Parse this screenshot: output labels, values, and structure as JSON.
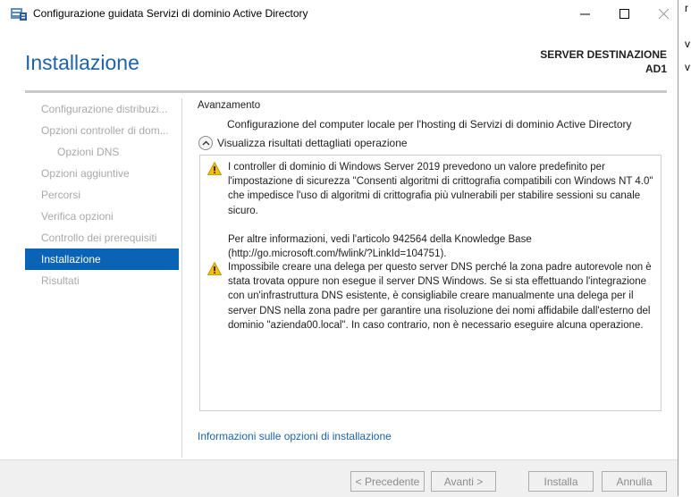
{
  "window": {
    "title": "Configurazione guidata Servizi di dominio Active Directory",
    "minimize_glyph": "—",
    "maximize_glyph": "☐",
    "close_glyph": "✕"
  },
  "header": {
    "page_title": "Installazione",
    "destination_label": "SERVER DESTINAZIONE",
    "destination_server": "AD1"
  },
  "nav": {
    "items": [
      {
        "label": "Configurazione distribuzi..."
      },
      {
        "label": "Opzioni controller di dom..."
      },
      {
        "label": "Opzioni DNS"
      },
      {
        "label": "Opzioni aggiuntive"
      },
      {
        "label": "Percorsi"
      },
      {
        "label": "Verifica opzioni"
      },
      {
        "label": "Controllo dei prerequisiti"
      },
      {
        "label": "Installazione"
      },
      {
        "label": "Risultati"
      }
    ]
  },
  "content": {
    "progress_label": "Avanzamento",
    "status": "Configurazione del computer locale per l'hosting di Servizi di dominio Active Directory",
    "details_toggle": "Visualizza risultati dettagliati operazione",
    "messages": [
      {
        "icon": "warning-icon",
        "text": "I controller di dominio di Windows Server 2019 prevedono un valore predefinito per l'impostazione di sicurezza \"Consenti algoritmi di crittografia compatibili con Windows NT 4.0\" che impedisce l'uso di algoritmi di crittografia più vulnerabili per stabilire sessioni su canale sicuro.",
        "extra": "Per altre informazioni, vedi l'articolo 942564 della Knowledge Base (http://go.microsoft.com/fwlink/?LinkId=104751)."
      },
      {
        "icon": "warning-icon",
        "text": "Impossibile creare una delega per questo server DNS perché la zona padre autorevole non è stata trovata oppure non esegue il server DNS Windows. Se si sta effettuando l'integrazione con un'infrastruttura DNS esistente, è consigliabile creare manualmente una delega per il server DNS nella zona padre per garantire una risoluzione dei nomi affidabile dall'esterno del dominio \"azienda00.local\". In caso contrario, non è necessario eseguire alcuna operazione."
      }
    ],
    "more_link": "Informazioni sulle opzioni di installazione"
  },
  "footer": {
    "prev": "< Precedente",
    "next": "Avanti >",
    "install": "Installa",
    "cancel": "Annulla"
  },
  "background_window_fragments": [
    "r",
    "v",
    "v"
  ],
  "colors": {
    "accent": "#1e63a8",
    "nav_active": "#0a63b4",
    "warning": "#f2c200"
  }
}
